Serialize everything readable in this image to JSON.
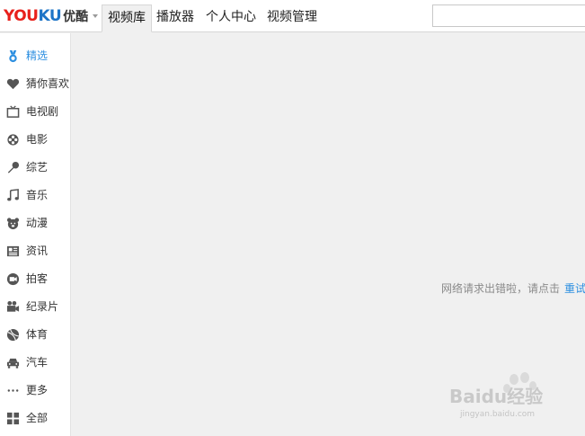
{
  "header": {
    "logo_text_1": "YOU",
    "logo_text_2": "KU",
    "logo_cn": "优酷",
    "tabs": [
      {
        "label": "视频库",
        "active": true
      },
      {
        "label": "播放器",
        "active": false
      },
      {
        "label": "个人中心",
        "active": false
      },
      {
        "label": "视频管理",
        "active": false
      }
    ],
    "search": {
      "value": "",
      "placeholder": ""
    }
  },
  "sidebar": {
    "items": [
      {
        "label": "精选",
        "icon": "medal-icon",
        "active": true
      },
      {
        "label": "猜你喜欢",
        "icon": "heart-icon",
        "active": false
      },
      {
        "label": "电视剧",
        "icon": "tv-icon",
        "active": false
      },
      {
        "label": "电影",
        "icon": "film-reel-icon",
        "active": false
      },
      {
        "label": "综艺",
        "icon": "microphone-icon",
        "active": false
      },
      {
        "label": "音乐",
        "icon": "music-note-icon",
        "active": false
      },
      {
        "label": "动漫",
        "icon": "bear-face-icon",
        "active": false
      },
      {
        "label": "资讯",
        "icon": "newspaper-icon",
        "active": false
      },
      {
        "label": "拍客",
        "icon": "camera-icon",
        "active": false
      },
      {
        "label": "纪录片",
        "icon": "movie-camera-icon",
        "active": false
      },
      {
        "label": "体育",
        "icon": "ball-icon",
        "active": false
      },
      {
        "label": "汽车",
        "icon": "car-icon",
        "active": false
      },
      {
        "label": "更多",
        "icon": "more-dots-icon",
        "active": false
      },
      {
        "label": "全部",
        "icon": "grid-icon",
        "active": false
      }
    ]
  },
  "main": {
    "error_message": "网络请求出错啦，请点击",
    "retry_label": "重试"
  },
  "watermark": {
    "text": "Baidu经验",
    "subtext": "jingyan.baidu.com"
  },
  "colors": {
    "accent": "#2d8fe0",
    "logo_red": "#e8201b",
    "logo_blue": "#1e74c7",
    "icon_gray": "#555555",
    "background": "#f0f0f0"
  }
}
